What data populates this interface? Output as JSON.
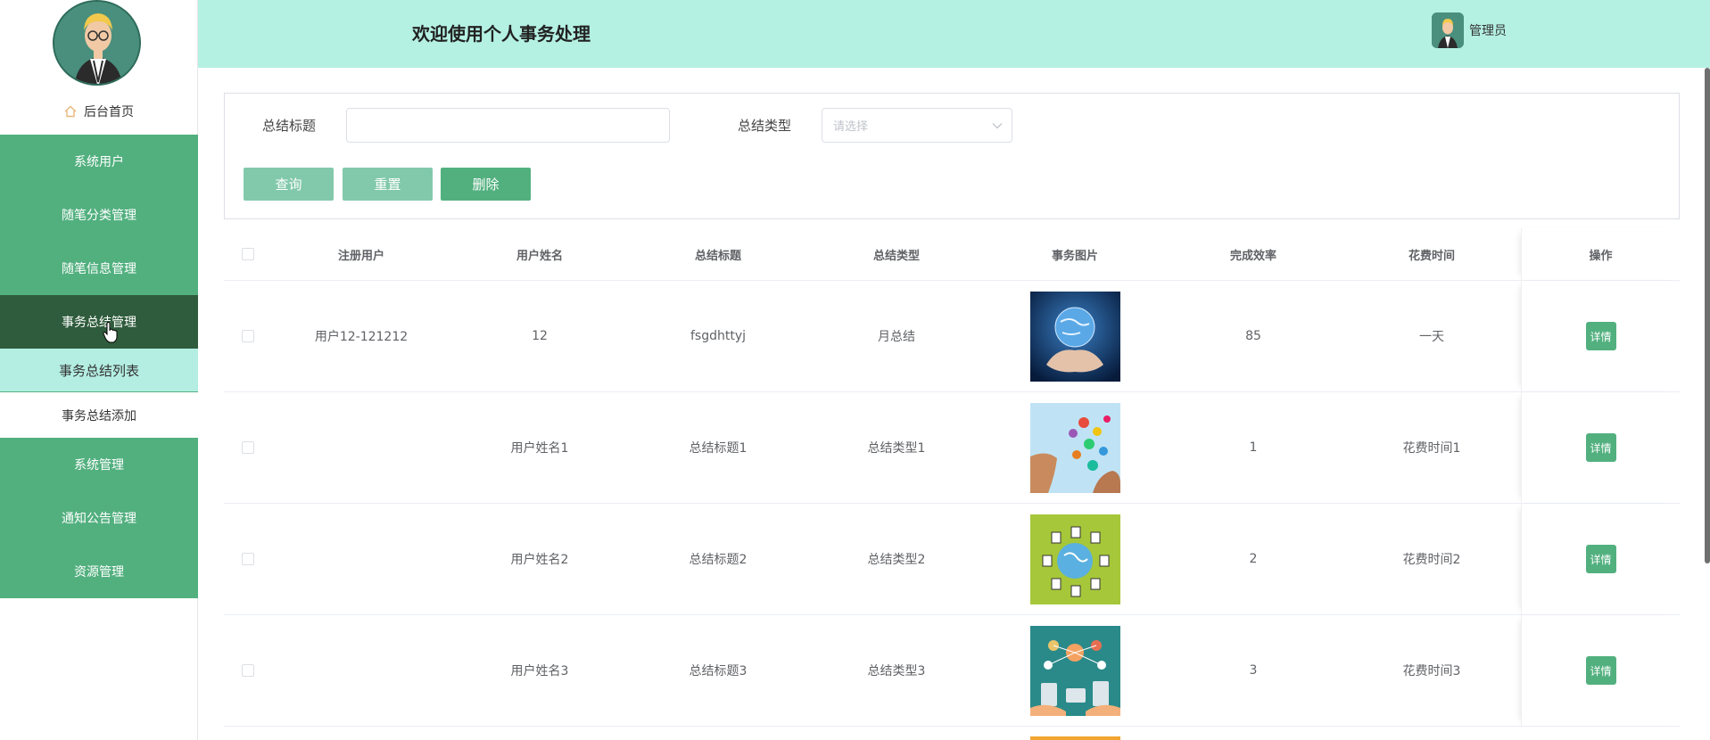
{
  "sidebar": {
    "home_label": "后台首页",
    "menu": [
      {
        "label": "系统用户"
      },
      {
        "label": "随笔分类管理"
      },
      {
        "label": "随笔信息管理"
      },
      {
        "label": "事务总结管理"
      }
    ],
    "submenu": [
      {
        "label": "事务总结列表"
      },
      {
        "label": "事务总结添加"
      }
    ],
    "menu2": [
      {
        "label": "系统管理"
      },
      {
        "label": "通知公告管理"
      },
      {
        "label": "资源管理"
      }
    ]
  },
  "header": {
    "title": "欢迎使用个人事务处理",
    "user_name": "管理员"
  },
  "search": {
    "title_label": "总结标题",
    "title_value": "",
    "type_label": "总结类型",
    "type_placeholder": "请选择",
    "query_label": "查询",
    "reset_label": "重置",
    "delete_label": "删除"
  },
  "table": {
    "headers": [
      "注册用户",
      "用户姓名",
      "总结标题",
      "总结类型",
      "事务图片",
      "完成效率",
      "花费时间",
      "操作"
    ],
    "detail_label": "详情",
    "rows": [
      {
        "user": "用户12-121212",
        "name": "12",
        "title": "fsgdhttyj",
        "type": "月总结",
        "image": "globe-hands-image",
        "efficiency": "85",
        "time": "一天"
      },
      {
        "user": "",
        "name": "用户姓名1",
        "title": "总结标题1",
        "type": "总结类型1",
        "image": "network-hand-image",
        "efficiency": "1",
        "time": "花费时间1"
      },
      {
        "user": "",
        "name": "用户姓名2",
        "title": "总结标题2",
        "type": "总结类型2",
        "image": "globe-people-image",
        "efficiency": "2",
        "time": "花费时间2"
      },
      {
        "user": "",
        "name": "用户姓名3",
        "title": "总结标题3",
        "type": "总结类型3",
        "image": "social-devices-image",
        "efficiency": "3",
        "time": "花费时间3"
      }
    ]
  },
  "colors": {
    "header_bg": "#b4f1e3",
    "menu_bg": "#52b07f",
    "menu_active_bg": "#2f5c3c",
    "submenu_selected_bg": "#b4eee3",
    "button_light": "#82c9ab",
    "button_dark": "#52b07f"
  }
}
